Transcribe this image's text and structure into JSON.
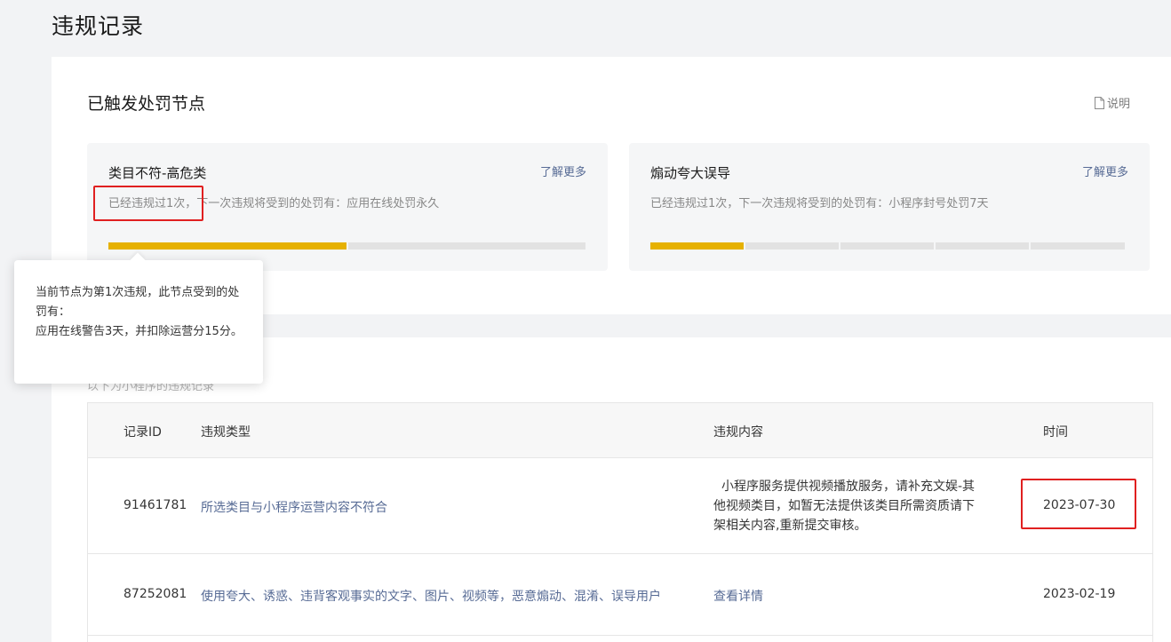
{
  "page": {
    "title": "违规记录"
  },
  "nodes": {
    "title": "已触发处罚节点",
    "explain_label": "说明",
    "cards": [
      {
        "title": "类目不符-高危类",
        "more_label": "了解更多",
        "desc": "已经违规过1次，下一次违规将受到的处罚有：应用在线处罚永久",
        "progress": {
          "filled": 1,
          "total": 2
        }
      },
      {
        "title": "煽动夸大误导",
        "more_label": "了解更多",
        "desc": "已经违规过1次，下一次违规将受到的处罚有：小程序封号处罚7天",
        "progress": {
          "filled": 1,
          "total": 5
        }
      }
    ]
  },
  "tooltip": {
    "text": "当前节点为第1次违规，此节点受到的处罚有：\n应用在线警告3天，并扣除运营分15分。"
  },
  "records": {
    "caption": "以下为小程序的违规记录",
    "columns": [
      "记录ID",
      "违规类型",
      "违规内容",
      "时间"
    ],
    "rows": [
      {
        "id": "91461781",
        "type": "所选类目与小程序运营内容不符合",
        "content": "小程序服务提供视频播放服务，请补充文娱-其他视频类目，如暂无法提供该类目所需资质请下架相关内容,重新提交审核。",
        "time": "2023-07-30"
      },
      {
        "id": "87252081",
        "type": "使用夸大、诱惑、违背客观事实的文字、图片、视频等，恶意煽动、混淆、误导用户",
        "content": "查看详情",
        "time": "2023-02-19"
      }
    ]
  },
  "colors": {
    "accent_link": "#576b95",
    "progress_on": "#e6b100",
    "progress_off": "#e2e2e2",
    "highlight": "#e02020"
  }
}
